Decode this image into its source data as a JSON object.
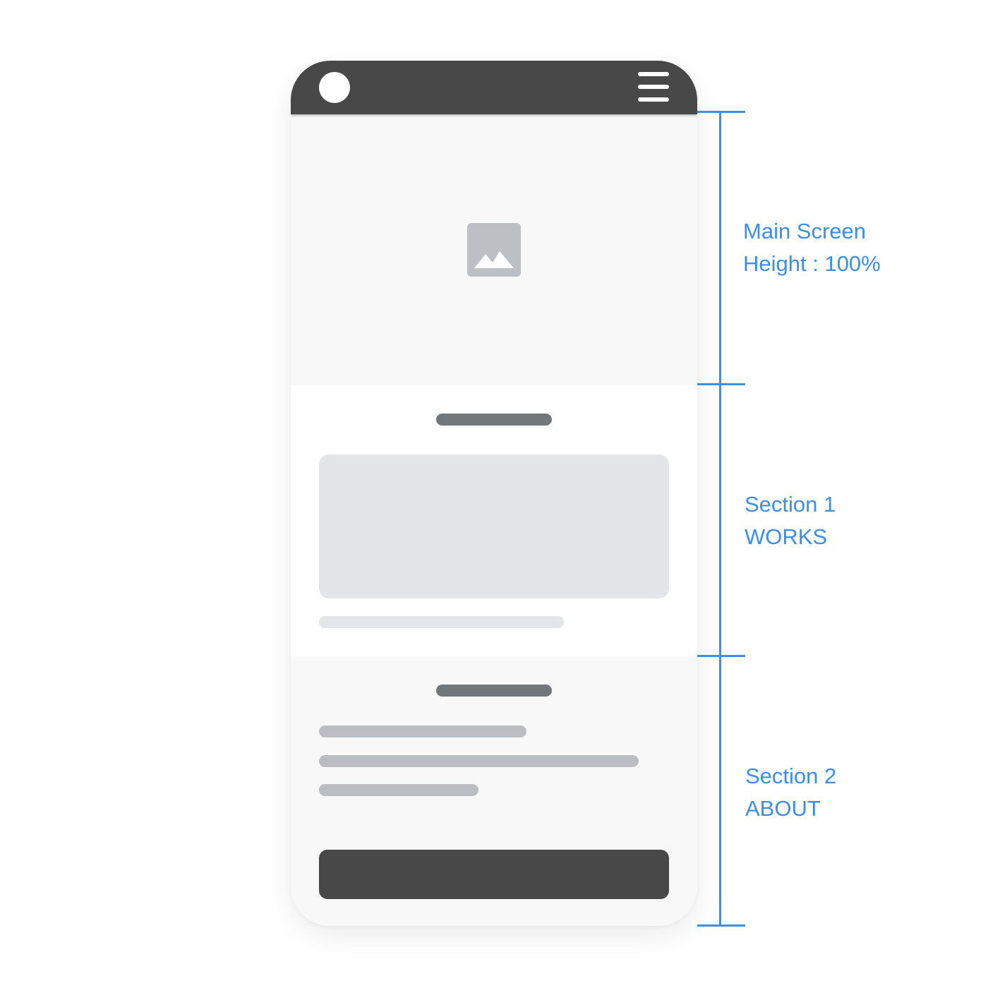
{
  "annotations": {
    "main_screen": {
      "line1": "Main Screen",
      "line2": "Height : 100%"
    },
    "section1": {
      "line1": "Section 1",
      "line2": "WORKS"
    },
    "section2": {
      "line1": "Section 2",
      "line2": "ABOUT"
    }
  },
  "icons": {
    "logo": "logo-circle",
    "menu": "hamburger-menu-icon",
    "hero_image": "image-placeholder-icon"
  },
  "colors": {
    "accent": "#3a8fe8",
    "header": "#484848",
    "button": "#484848",
    "title_bar": "#72777c",
    "text_line": "#babec3",
    "placeholder": "#e4e5e9"
  }
}
